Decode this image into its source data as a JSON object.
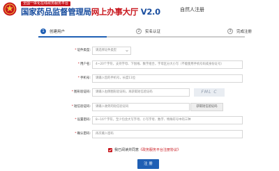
{
  "header": {
    "platform_tag": "全国一体化在线政务服务平台",
    "title_main": "国家药品监督管理局",
    "title_highlight": "网上办事大厅",
    "title_version": " V2.0",
    "page_name": "自然人注册"
  },
  "steps": [
    {
      "number": "1",
      "label": "创建用户",
      "active": true
    },
    {
      "number": "2",
      "label": "实名认证",
      "active": false
    },
    {
      "number": "3",
      "label": "完成注册",
      "active": false
    }
  ],
  "form": {
    "id_type": {
      "label": "证件类型:",
      "placeholder": "请选择证件类型"
    },
    "username": {
      "label": "用户名:",
      "placeholder": "4~20个字符，支持字母、下划线、数字组合，字母区分大小写（不能使用手机号码或身份证号）"
    },
    "phone": {
      "label": "手机号:",
      "placeholder": "请输入您的手机号，长度11位"
    },
    "captcha": {
      "label": "图形验证码:",
      "placeholder": "请输入右侧图形验证码，再获取短信验证码",
      "image_text": "FML C"
    },
    "sms_code": {
      "label": "短信验证码:",
      "placeholder": "请输入收到的短信验证码",
      "button": "获取短信验证码"
    },
    "password": {
      "label": "设置密码:",
      "placeholder": "8~16个字符，至少包含大写字母、小写字母、数字、特殊符号中的三种"
    },
    "confirm_password": {
      "label": "确认密码:",
      "placeholder": "再次输入密码"
    }
  },
  "agreement": {
    "text": "我已阅读并同意",
    "link": "《政务服务平台注册协议》",
    "checked": true
  },
  "submit_label": "注 册",
  "colors": {
    "primary_blue": "#1f5fb4",
    "brand_red": "#c8161d"
  }
}
